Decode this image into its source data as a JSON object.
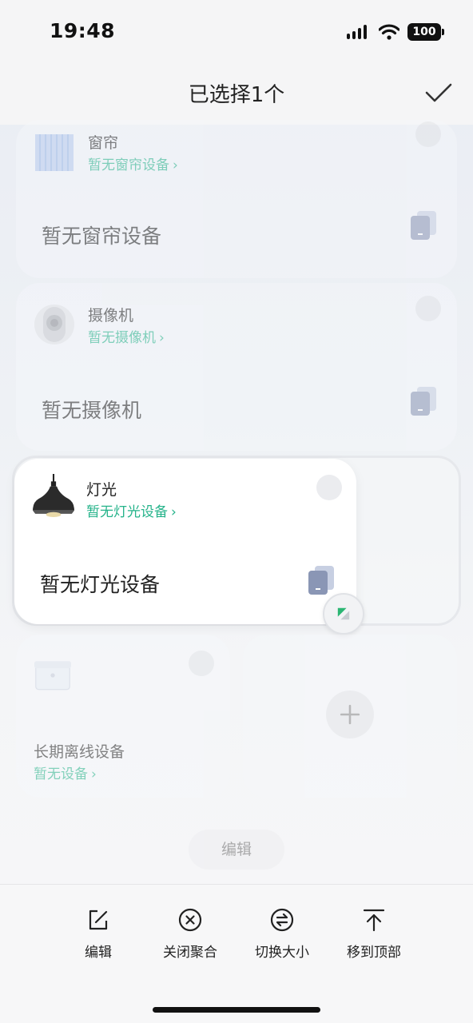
{
  "status_bar": {
    "time": "19:48",
    "battery": "100"
  },
  "header": {
    "title": "已选择1个"
  },
  "cards": {
    "curtain": {
      "title": "窗帘",
      "link": "暂无窗帘设备",
      "body": "暂无窗帘设备"
    },
    "camera": {
      "title": "摄像机",
      "link": "暂无摄像机",
      "body": "暂无摄像机"
    },
    "light": {
      "title": "灯光",
      "link": "暂无灯光设备",
      "body": "暂无灯光设备"
    },
    "offline": {
      "title": "长期离线设备",
      "link": "暂无设备"
    }
  },
  "edit_button": "编辑",
  "toolbar": {
    "edit": "编辑",
    "close_group": "关闭聚合",
    "switch_size": "切换大小",
    "move_top": "移到顶部"
  },
  "colors": {
    "accent": "#25b38a",
    "device": "#8a96b5"
  }
}
